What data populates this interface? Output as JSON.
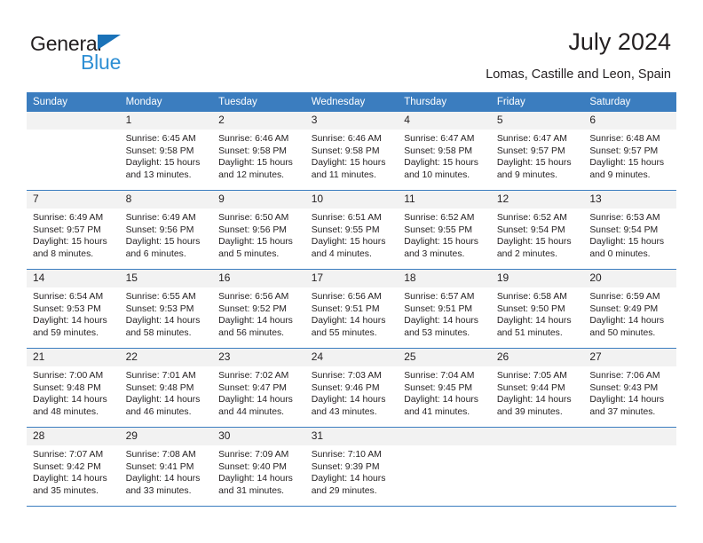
{
  "brand": {
    "name_part1": "General",
    "name_part2": "Blue",
    "triangle_icon": "triangle-icon",
    "color_dark": "#231f20",
    "color_blue": "#2e8fd4"
  },
  "header": {
    "title": "July 2024",
    "subtitle": "Lomas, Castille and Leon, Spain"
  },
  "theme": {
    "header_bg": "#3b7dbf",
    "daynum_bg": "#f2f2f2",
    "border": "#3b7dbf",
    "text": "#231f20"
  },
  "calendar": {
    "weekday_headers": [
      "Sunday",
      "Monday",
      "Tuesday",
      "Wednesday",
      "Thursday",
      "Friday",
      "Saturday"
    ],
    "weeks": [
      [
        {
          "day": "",
          "sunrise": "",
          "sunset": "",
          "daylight_line1": "",
          "daylight_line2": "",
          "empty": true
        },
        {
          "day": "1",
          "sunrise": "Sunrise: 6:45 AM",
          "sunset": "Sunset: 9:58 PM",
          "daylight_line1": "Daylight: 15 hours",
          "daylight_line2": "and 13 minutes."
        },
        {
          "day": "2",
          "sunrise": "Sunrise: 6:46 AM",
          "sunset": "Sunset: 9:58 PM",
          "daylight_line1": "Daylight: 15 hours",
          "daylight_line2": "and 12 minutes."
        },
        {
          "day": "3",
          "sunrise": "Sunrise: 6:46 AM",
          "sunset": "Sunset: 9:58 PM",
          "daylight_line1": "Daylight: 15 hours",
          "daylight_line2": "and 11 minutes."
        },
        {
          "day": "4",
          "sunrise": "Sunrise: 6:47 AM",
          "sunset": "Sunset: 9:58 PM",
          "daylight_line1": "Daylight: 15 hours",
          "daylight_line2": "and 10 minutes."
        },
        {
          "day": "5",
          "sunrise": "Sunrise: 6:47 AM",
          "sunset": "Sunset: 9:57 PM",
          "daylight_line1": "Daylight: 15 hours",
          "daylight_line2": "and 9 minutes."
        },
        {
          "day": "6",
          "sunrise": "Sunrise: 6:48 AM",
          "sunset": "Sunset: 9:57 PM",
          "daylight_line1": "Daylight: 15 hours",
          "daylight_line2": "and 9 minutes."
        }
      ],
      [
        {
          "day": "7",
          "sunrise": "Sunrise: 6:49 AM",
          "sunset": "Sunset: 9:57 PM",
          "daylight_line1": "Daylight: 15 hours",
          "daylight_line2": "and 8 minutes."
        },
        {
          "day": "8",
          "sunrise": "Sunrise: 6:49 AM",
          "sunset": "Sunset: 9:56 PM",
          "daylight_line1": "Daylight: 15 hours",
          "daylight_line2": "and 6 minutes."
        },
        {
          "day": "9",
          "sunrise": "Sunrise: 6:50 AM",
          "sunset": "Sunset: 9:56 PM",
          "daylight_line1": "Daylight: 15 hours",
          "daylight_line2": "and 5 minutes."
        },
        {
          "day": "10",
          "sunrise": "Sunrise: 6:51 AM",
          "sunset": "Sunset: 9:55 PM",
          "daylight_line1": "Daylight: 15 hours",
          "daylight_line2": "and 4 minutes."
        },
        {
          "day": "11",
          "sunrise": "Sunrise: 6:52 AM",
          "sunset": "Sunset: 9:55 PM",
          "daylight_line1": "Daylight: 15 hours",
          "daylight_line2": "and 3 minutes."
        },
        {
          "day": "12",
          "sunrise": "Sunrise: 6:52 AM",
          "sunset": "Sunset: 9:54 PM",
          "daylight_line1": "Daylight: 15 hours",
          "daylight_line2": "and 2 minutes."
        },
        {
          "day": "13",
          "sunrise": "Sunrise: 6:53 AM",
          "sunset": "Sunset: 9:54 PM",
          "daylight_line1": "Daylight: 15 hours",
          "daylight_line2": "and 0 minutes."
        }
      ],
      [
        {
          "day": "14",
          "sunrise": "Sunrise: 6:54 AM",
          "sunset": "Sunset: 9:53 PM",
          "daylight_line1": "Daylight: 14 hours",
          "daylight_line2": "and 59 minutes."
        },
        {
          "day": "15",
          "sunrise": "Sunrise: 6:55 AM",
          "sunset": "Sunset: 9:53 PM",
          "daylight_line1": "Daylight: 14 hours",
          "daylight_line2": "and 58 minutes."
        },
        {
          "day": "16",
          "sunrise": "Sunrise: 6:56 AM",
          "sunset": "Sunset: 9:52 PM",
          "daylight_line1": "Daylight: 14 hours",
          "daylight_line2": "and 56 minutes."
        },
        {
          "day": "17",
          "sunrise": "Sunrise: 6:56 AM",
          "sunset": "Sunset: 9:51 PM",
          "daylight_line1": "Daylight: 14 hours",
          "daylight_line2": "and 55 minutes."
        },
        {
          "day": "18",
          "sunrise": "Sunrise: 6:57 AM",
          "sunset": "Sunset: 9:51 PM",
          "daylight_line1": "Daylight: 14 hours",
          "daylight_line2": "and 53 minutes."
        },
        {
          "day": "19",
          "sunrise": "Sunrise: 6:58 AM",
          "sunset": "Sunset: 9:50 PM",
          "daylight_line1": "Daylight: 14 hours",
          "daylight_line2": "and 51 minutes."
        },
        {
          "day": "20",
          "sunrise": "Sunrise: 6:59 AM",
          "sunset": "Sunset: 9:49 PM",
          "daylight_line1": "Daylight: 14 hours",
          "daylight_line2": "and 50 minutes."
        }
      ],
      [
        {
          "day": "21",
          "sunrise": "Sunrise: 7:00 AM",
          "sunset": "Sunset: 9:48 PM",
          "daylight_line1": "Daylight: 14 hours",
          "daylight_line2": "and 48 minutes."
        },
        {
          "day": "22",
          "sunrise": "Sunrise: 7:01 AM",
          "sunset": "Sunset: 9:48 PM",
          "daylight_line1": "Daylight: 14 hours",
          "daylight_line2": "and 46 minutes."
        },
        {
          "day": "23",
          "sunrise": "Sunrise: 7:02 AM",
          "sunset": "Sunset: 9:47 PM",
          "daylight_line1": "Daylight: 14 hours",
          "daylight_line2": "and 44 minutes."
        },
        {
          "day": "24",
          "sunrise": "Sunrise: 7:03 AM",
          "sunset": "Sunset: 9:46 PM",
          "daylight_line1": "Daylight: 14 hours",
          "daylight_line2": "and 43 minutes."
        },
        {
          "day": "25",
          "sunrise": "Sunrise: 7:04 AM",
          "sunset": "Sunset: 9:45 PM",
          "daylight_line1": "Daylight: 14 hours",
          "daylight_line2": "and 41 minutes."
        },
        {
          "day": "26",
          "sunrise": "Sunrise: 7:05 AM",
          "sunset": "Sunset: 9:44 PM",
          "daylight_line1": "Daylight: 14 hours",
          "daylight_line2": "and 39 minutes."
        },
        {
          "day": "27",
          "sunrise": "Sunrise: 7:06 AM",
          "sunset": "Sunset: 9:43 PM",
          "daylight_line1": "Daylight: 14 hours",
          "daylight_line2": "and 37 minutes."
        }
      ],
      [
        {
          "day": "28",
          "sunrise": "Sunrise: 7:07 AM",
          "sunset": "Sunset: 9:42 PM",
          "daylight_line1": "Daylight: 14 hours",
          "daylight_line2": "and 35 minutes."
        },
        {
          "day": "29",
          "sunrise": "Sunrise: 7:08 AM",
          "sunset": "Sunset: 9:41 PM",
          "daylight_line1": "Daylight: 14 hours",
          "daylight_line2": "and 33 minutes."
        },
        {
          "day": "30",
          "sunrise": "Sunrise: 7:09 AM",
          "sunset": "Sunset: 9:40 PM",
          "daylight_line1": "Daylight: 14 hours",
          "daylight_line2": "and 31 minutes."
        },
        {
          "day": "31",
          "sunrise": "Sunrise: 7:10 AM",
          "sunset": "Sunset: 9:39 PM",
          "daylight_line1": "Daylight: 14 hours",
          "daylight_line2": "and 29 minutes."
        },
        {
          "day": "",
          "sunrise": "",
          "sunset": "",
          "daylight_line1": "",
          "daylight_line2": "",
          "empty": true
        },
        {
          "day": "",
          "sunrise": "",
          "sunset": "",
          "daylight_line1": "",
          "daylight_line2": "",
          "empty": true
        },
        {
          "day": "",
          "sunrise": "",
          "sunset": "",
          "daylight_line1": "",
          "daylight_line2": "",
          "empty": true
        }
      ]
    ]
  }
}
